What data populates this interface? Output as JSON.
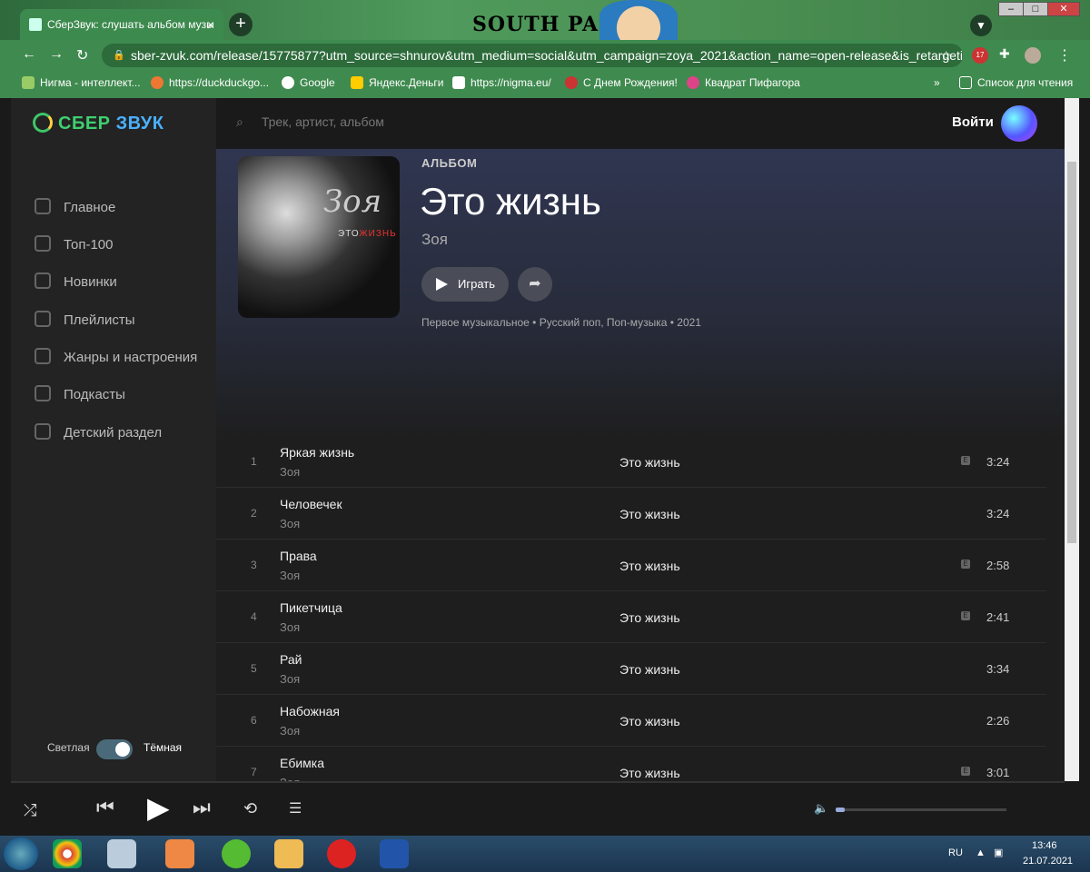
{
  "browser": {
    "tab_title": "СберЗвук: слушать альбом музы",
    "close": "×",
    "new_tab": "+",
    "deco_text": "SOUTH PARK",
    "url": "sber-zvuk.com/release/15775877?utm_source=shnurov&utm_medium=social&utm_campaign=zoya_2021&action_name=open-release&is_retargetin...",
    "ext_badge": "17",
    "bookmarks": [
      "Нигма - интеллект...",
      "https://duckduckgo...",
      "Google",
      "Яндекс.Деньги",
      "https://nigma.eu/",
      "С Днем Рождения!",
      "Квадрат Пифагора"
    ],
    "bookmark_more": "»",
    "reading_list": "Список для чтения"
  },
  "app": {
    "logo_sber": "СБЕР",
    "logo_zvuk": "ЗВУК",
    "search_placeholder": "Трек, артист, альбом",
    "login": "Войти",
    "nav": [
      "Главное",
      "Топ-100",
      "Новинки",
      "Плейлисты",
      "Жанры и настроения",
      "Подкасты",
      "Детский раздел"
    ],
    "theme_light": "Светлая",
    "theme_dark": "Тёмная"
  },
  "album": {
    "kind": "АЛЬБОМ",
    "title": "Это жизнь",
    "artist": "Зоя",
    "play": "Играть",
    "label": "Первое музыкальное",
    "genres": "Русский поп, Поп-музыка",
    "year": "2021",
    "cover_title": "Зоя",
    "cover_sub1": "ЭТО",
    "cover_sub2": "ЖИЗНЬ"
  },
  "tracks": [
    {
      "n": "1",
      "title": "Яркая жизнь",
      "artist": "Зоя",
      "album": "Это жизнь",
      "explicit": true,
      "duration": "3:24"
    },
    {
      "n": "2",
      "title": "Человечек",
      "artist": "Зоя",
      "album": "Это жизнь",
      "explicit": false,
      "duration": "3:24"
    },
    {
      "n": "3",
      "title": "Права",
      "artist": "Зоя",
      "album": "Это жизнь",
      "explicit": true,
      "duration": "2:58"
    },
    {
      "n": "4",
      "title": "Пикетчица",
      "artist": "Зоя",
      "album": "Это жизнь",
      "explicit": true,
      "duration": "2:41"
    },
    {
      "n": "5",
      "title": "Рай",
      "artist": "Зоя",
      "album": "Это жизнь",
      "explicit": false,
      "duration": "3:34"
    },
    {
      "n": "6",
      "title": "Набожная",
      "artist": "Зоя",
      "album": "Это жизнь",
      "explicit": false,
      "duration": "2:26"
    },
    {
      "n": "7",
      "title": "Ебимка",
      "artist": "Зоя",
      "album": "Это жизнь",
      "explicit": true,
      "duration": "3:01"
    }
  ],
  "taskbar": {
    "lang": "RU",
    "time": "13:46",
    "date": "21.07.2021"
  }
}
